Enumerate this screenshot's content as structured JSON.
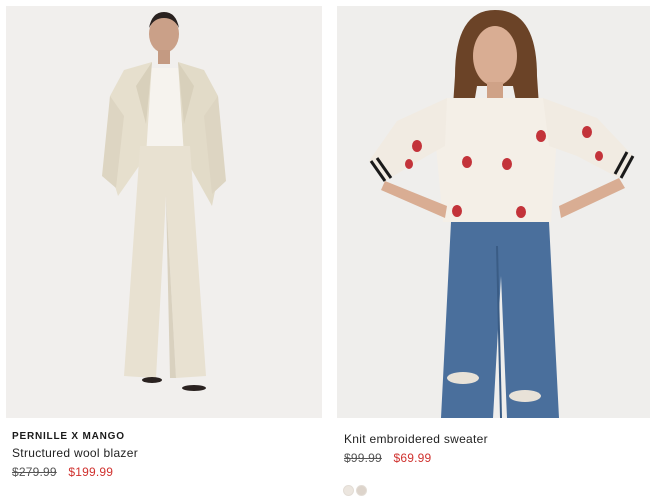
{
  "products": [
    {
      "brand": "PERNILLE X MANGO",
      "name": "Structured wool blazer",
      "price_original": "$279.99",
      "price_sale": "$199.99",
      "image_alt": "Model wearing cream structured wool blazer with matching wide trousers"
    },
    {
      "name": "Knit embroidered sweater",
      "price_original": "$99.99",
      "price_sale": "$69.99",
      "image_alt": "Model wearing white knit sweater with embroidered strawberries and ripped blue jeans",
      "swatch_colors": [
        "#ece6df",
        "#ddd4cb"
      ]
    }
  ],
  "colors": {
    "sale_price": "#d0322f",
    "text": "#1a1a1a",
    "photo_bg": "#f1efed"
  }
}
